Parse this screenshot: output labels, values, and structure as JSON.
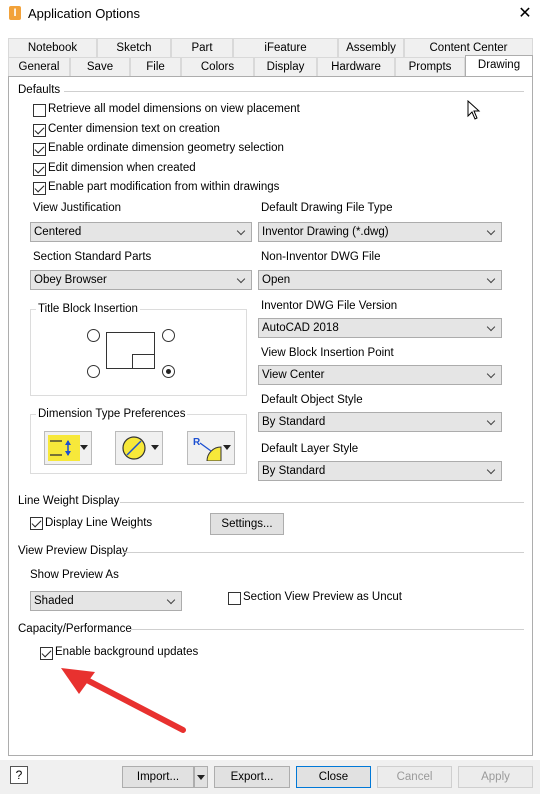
{
  "window": {
    "title": "Application Options",
    "close_glyph": "✕"
  },
  "tabs_row1": [
    "Notebook",
    "Sketch",
    "Part",
    "iFeature",
    "Assembly",
    "Content Center"
  ],
  "tabs_row2": [
    "General",
    "Save",
    "File",
    "Colors",
    "Display",
    "Hardware",
    "Prompts",
    "Drawing"
  ],
  "active_tab": "Drawing",
  "defaults": {
    "label": "Defaults",
    "options": [
      {
        "label": "Retrieve all model dimensions on view placement",
        "checked": false
      },
      {
        "label": "Center dimension text on creation",
        "checked": true
      },
      {
        "label": "Enable ordinate dimension geometry selection",
        "checked": true
      },
      {
        "label": "Edit dimension when created",
        "checked": true
      },
      {
        "label": "Enable part modification from within drawings",
        "checked": true
      }
    ],
    "view_justification": {
      "label": "View Justification",
      "value": "Centered"
    },
    "section_standard_parts": {
      "label": "Section Standard Parts",
      "value": "Obey Browser"
    },
    "title_block_insertion": {
      "label": "Title Block Insertion",
      "selected": "bottom-right"
    },
    "dimension_type_preferences": {
      "label": "Dimension Type Preferences"
    },
    "default_drawing_file_type": {
      "label": "Default Drawing File Type",
      "value": "Inventor Drawing (*.dwg)"
    },
    "non_inventor_dwg_file": {
      "label": "Non-Inventor DWG File",
      "value": "Open"
    },
    "inventor_dwg_file_version": {
      "label": "Inventor DWG File Version",
      "value": "AutoCAD 2018"
    },
    "view_block_insertion_point": {
      "label": "View Block Insertion Point",
      "value": "View Center"
    },
    "default_object_style": {
      "label": "Default Object Style",
      "value": "By Standard"
    },
    "default_layer_style": {
      "label": "Default Layer Style",
      "value": "By Standard"
    }
  },
  "line_weight": {
    "label": "Line Weight Display",
    "display_line_weights": {
      "label": "Display Line Weights",
      "checked": true
    },
    "settings_button": "Settings..."
  },
  "view_preview": {
    "label": "View Preview Display",
    "show_preview_as": {
      "label": "Show Preview As",
      "value": "Shaded"
    },
    "section_uncut": {
      "label": "Section View Preview as Uncut",
      "checked": false
    }
  },
  "capacity": {
    "label": "Capacity/Performance",
    "background_updates": {
      "label": "Enable background updates",
      "checked": true
    }
  },
  "footer": {
    "help": "?",
    "import": "Import...",
    "export": "Export...",
    "close": "Close",
    "cancel": "Cancel",
    "apply": "Apply"
  },
  "colors": {
    "annotation_arrow": "#e8312f",
    "icon_yellow": "#f7e83a",
    "focus_blue": "#0078d7"
  }
}
